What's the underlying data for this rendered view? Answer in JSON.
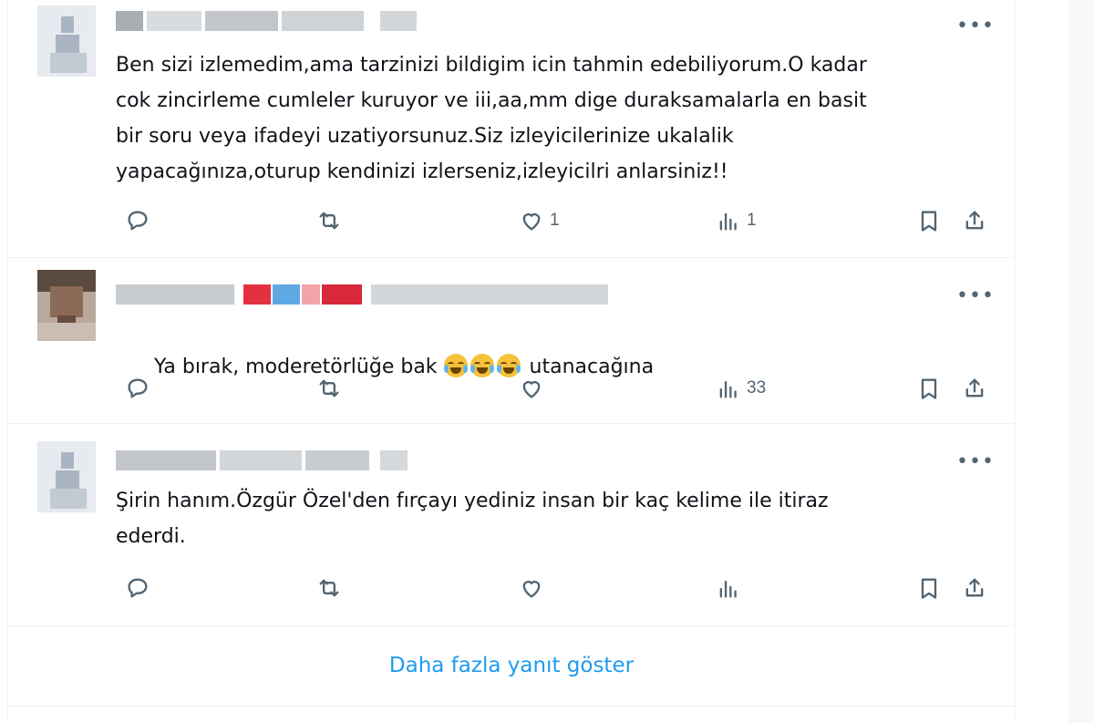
{
  "replies": [
    {
      "text": "Ben sizi izlemedim,ama tarzinizi bildigim icin tahmin edebiliyorum.O kadar\ncok zincirleme cumleler kuruyor ve iii,aa,mm dige duraksamalarla en basit\nbir soru veya ifadeyi uzatiyorsunuz.Siz izleyicilerinize ukalalik\nyapacağınıza,oturup kendinizi izlerseniz,izleyicilri anlarsiniz!!",
      "more_label": "•••",
      "likes": "1",
      "views": "1"
    },
    {
      "text_before": "Ya bırak, moderetörlüğe bak ",
      "text_after": " utanacağına",
      "more_label": "•••",
      "likes": "",
      "views": "33"
    },
    {
      "text": "Şirin hanım.Özgür Özel'den fırçayı yediniz insan bir kaç kelime ile itiraz\nederdi.",
      "more_label": "•••",
      "likes": "",
      "views": ""
    }
  ],
  "show_more_label": "Daha fazla yanıt göster",
  "icons": [
    "reply-icon",
    "retweet-icon",
    "like-icon",
    "views-icon",
    "bookmark-icon",
    "share-icon"
  ],
  "colors": {
    "link": "#1d9bf0",
    "text": "#0f1419",
    "muted": "#536471",
    "border": "#eff3f4"
  }
}
